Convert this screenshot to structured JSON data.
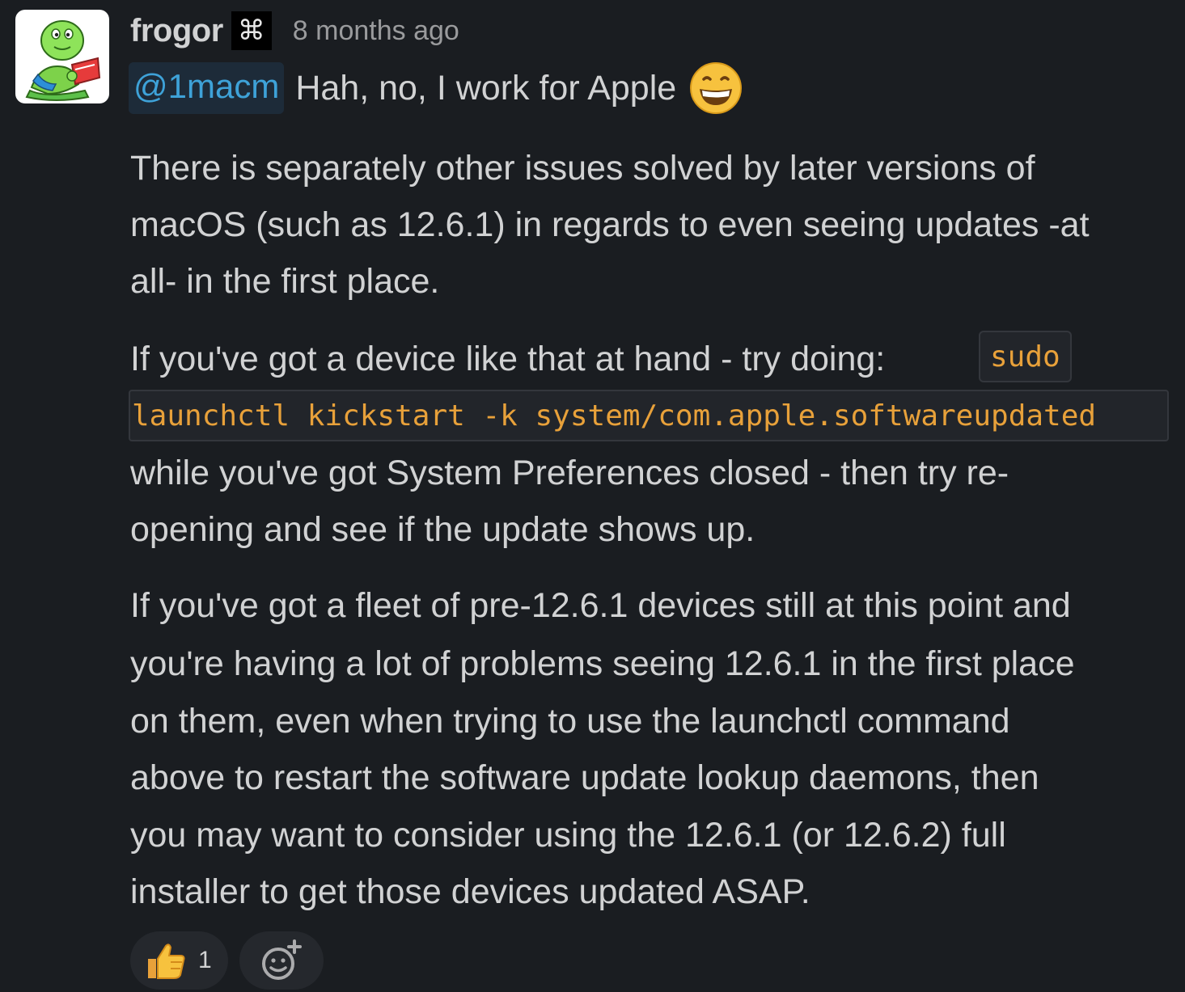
{
  "message": {
    "author": "frogor",
    "author_badge": "⌘",
    "timestamp": "8 months ago",
    "mention": "@1macm",
    "first_line": "Hah, no, I work for Apple",
    "first_line_emoji": "grinning-face-icon",
    "paragraph_1": [
      "There is separately other issues solved by later versions of",
      "macOS (such as 12.6.1) in regards to even seeing updates -at",
      "all- in the first place."
    ],
    "paragraph_2_line_1": "If you've got a device like that at hand - try doing:",
    "code_part_1": "sudo",
    "code_part_2": "launchctl kickstart -k system/com.apple.softwareupdated",
    "paragraph_2_rest": [
      "while you've got System Preferences closed - then try re-",
      "opening and see if the update shows up."
    ],
    "paragraph_3": [
      "If you've got a fleet of pre-12.6.1 devices still at this point and",
      "you're having a lot of problems seeing 12.6.1 in the first place",
      "on them, even when trying to use the launchctl command",
      "above to restart the software update lookup daemons, then",
      "you may want to consider using the 12.6.1 (or 12.6.2) full",
      "installer to get those devices updated ASAP."
    ]
  },
  "reactions": [
    {
      "emoji": "thumbs-up-icon",
      "count": "1"
    }
  ],
  "add_reaction_icon": "add-reaction-icon",
  "colors": {
    "background": "#1a1d21",
    "text": "#d1d2d3",
    "mention_text": "#3ea2d8",
    "mention_bg": "#1d2b39",
    "code_text": "#e8a13a",
    "timestamp": "#9a9b9d"
  }
}
